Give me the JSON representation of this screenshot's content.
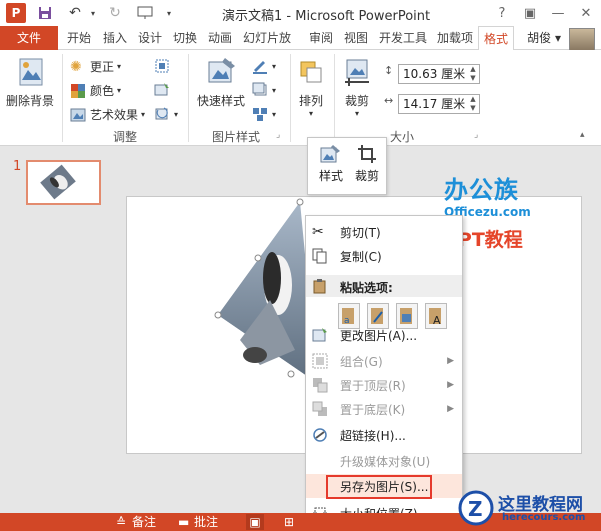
{
  "titlebar": {
    "title": "演示文稿1 - Microsoft PowerPoint",
    "app_icon": "P",
    "win_help": "?",
    "win_restore": "▣",
    "win_minimize": "—",
    "win_maximize": "□",
    "win_close": "✕"
  },
  "tabs": {
    "file": "文件",
    "items": [
      "开始",
      "插入",
      "设计",
      "切换",
      "动画",
      "幻灯片放",
      "审阅",
      "视图",
      "开发工具",
      "加载项",
      "格式"
    ],
    "active": "格式",
    "user": "胡俊 ▾"
  },
  "ribbon": {
    "remove_bg": "删除背景",
    "corrections": "更正",
    "color": "颜色",
    "artistic": "艺术效果",
    "adjust_group": "调整",
    "quick_styles": "快速样式",
    "picture_styles_group": "图片样式",
    "arrange": "排列",
    "crop": "裁剪",
    "size_group": "大小",
    "height": "10.63 厘米",
    "width": "14.17 厘米"
  },
  "minibar": {
    "style": "样式",
    "crop": "裁剪"
  },
  "slide_number": "1",
  "watermark_top": {
    "line1": "办公族",
    "line2": "Officezu.com",
    "line3": "PPT教程"
  },
  "watermark_bottom": {
    "line1": "这里教程网",
    "line2": "herecours.com"
  },
  "context_menu": {
    "cut": "剪切(T)",
    "copy": "复制(C)",
    "paste_options": "粘贴选项:",
    "change_picture": "更改图片(A)...",
    "group": "组合(G)",
    "bring_front": "置于顶层(R)",
    "send_back": "置于底层(K)",
    "hyperlink": "超链接(H)...",
    "upgrade_media": "升级媒体对象(U)",
    "save_as_picture": "另存为图片(S)...",
    "size_position": "大小和位置(Z)..."
  },
  "statusbar": {
    "notes": "备注",
    "comments": "批注"
  },
  "colors": {
    "accent": "#d24726",
    "highlight_box": "#e53a2c"
  }
}
